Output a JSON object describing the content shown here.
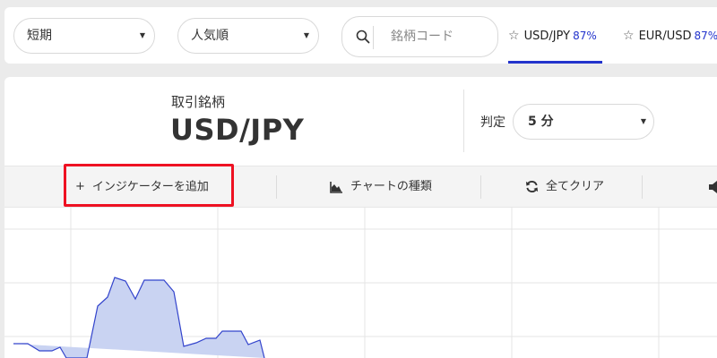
{
  "filters": {
    "period": "短期",
    "sort": "人気順",
    "search_placeholder": "銘柄コード"
  },
  "pair_tabs": [
    {
      "symbol": "USD/JPY",
      "rate": "87%",
      "active": true
    },
    {
      "symbol": "EUR/USD",
      "rate": "87%",
      "active": false
    }
  ],
  "symbol": {
    "label": "取引銘柄",
    "value": "USD/JPY"
  },
  "judgement": {
    "label": "判定",
    "timeframe": "5 分"
  },
  "toolbar": {
    "add_indicator": "インジケーターを追加",
    "chart_type": "チャートの種類",
    "clear_all": "全てクリア"
  },
  "colors": {
    "accent": "#2233cc",
    "highlight": "#ee1122",
    "area_fill": "#c9d3f2",
    "area_line": "#3344cc"
  },
  "icons": {
    "search": "search-icon",
    "star": "star-outline-icon",
    "plus": "plus-icon",
    "chart_type": "area-chart-icon",
    "refresh": "refresh-icon",
    "sound": "speaker-icon",
    "dropdown": "caret-down-icon"
  }
}
